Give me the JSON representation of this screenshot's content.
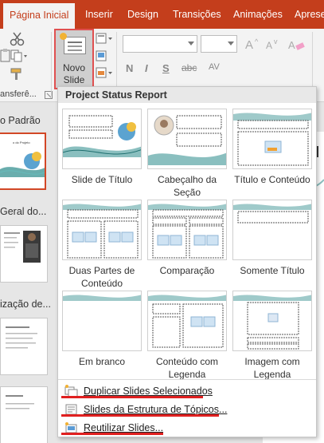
{
  "tabs": [
    "Página Inicial",
    "Inserir",
    "Design",
    "Transições",
    "Animações",
    "Aprese"
  ],
  "ribbon": {
    "new_slide_line1": "Novo",
    "new_slide_line2": "Slide",
    "clipboard_group_label": "ansferê...",
    "format_buttons": [
      "N",
      "I",
      "S",
      "abc",
      "AV"
    ]
  },
  "left_pane": {
    "sections": [
      "o Padrão",
      "Geral do...",
      "ização de..."
    ],
    "first_thumb_title": "o do Projeto"
  },
  "menu": {
    "header": "Project Status Report",
    "layouts": [
      {
        "line1": "Slide de Título",
        "line2": ""
      },
      {
        "line1": "Cabeçalho da",
        "line2": "Seção"
      },
      {
        "line1": "Título e Conteúdo",
        "line2": ""
      },
      {
        "line1": "Duas Partes de",
        "line2": "Conteúdo"
      },
      {
        "line1": "Comparação",
        "line2": ""
      },
      {
        "line1": "Somente Título",
        "line2": ""
      },
      {
        "line1": "Em branco",
        "line2": ""
      },
      {
        "line1": "Conteúdo com",
        "line2": "Legenda"
      },
      {
        "line1": "Imagem com",
        "line2": "Legenda"
      }
    ],
    "items": [
      "Duplicar Slides Selecionados",
      "Slides da Estrutura de Tópicos...",
      "Reutilizar Slides..."
    ]
  },
  "colors": {
    "accent": "#c43e1c",
    "highlight": "#e02020",
    "teal": "#2a8a8a"
  }
}
